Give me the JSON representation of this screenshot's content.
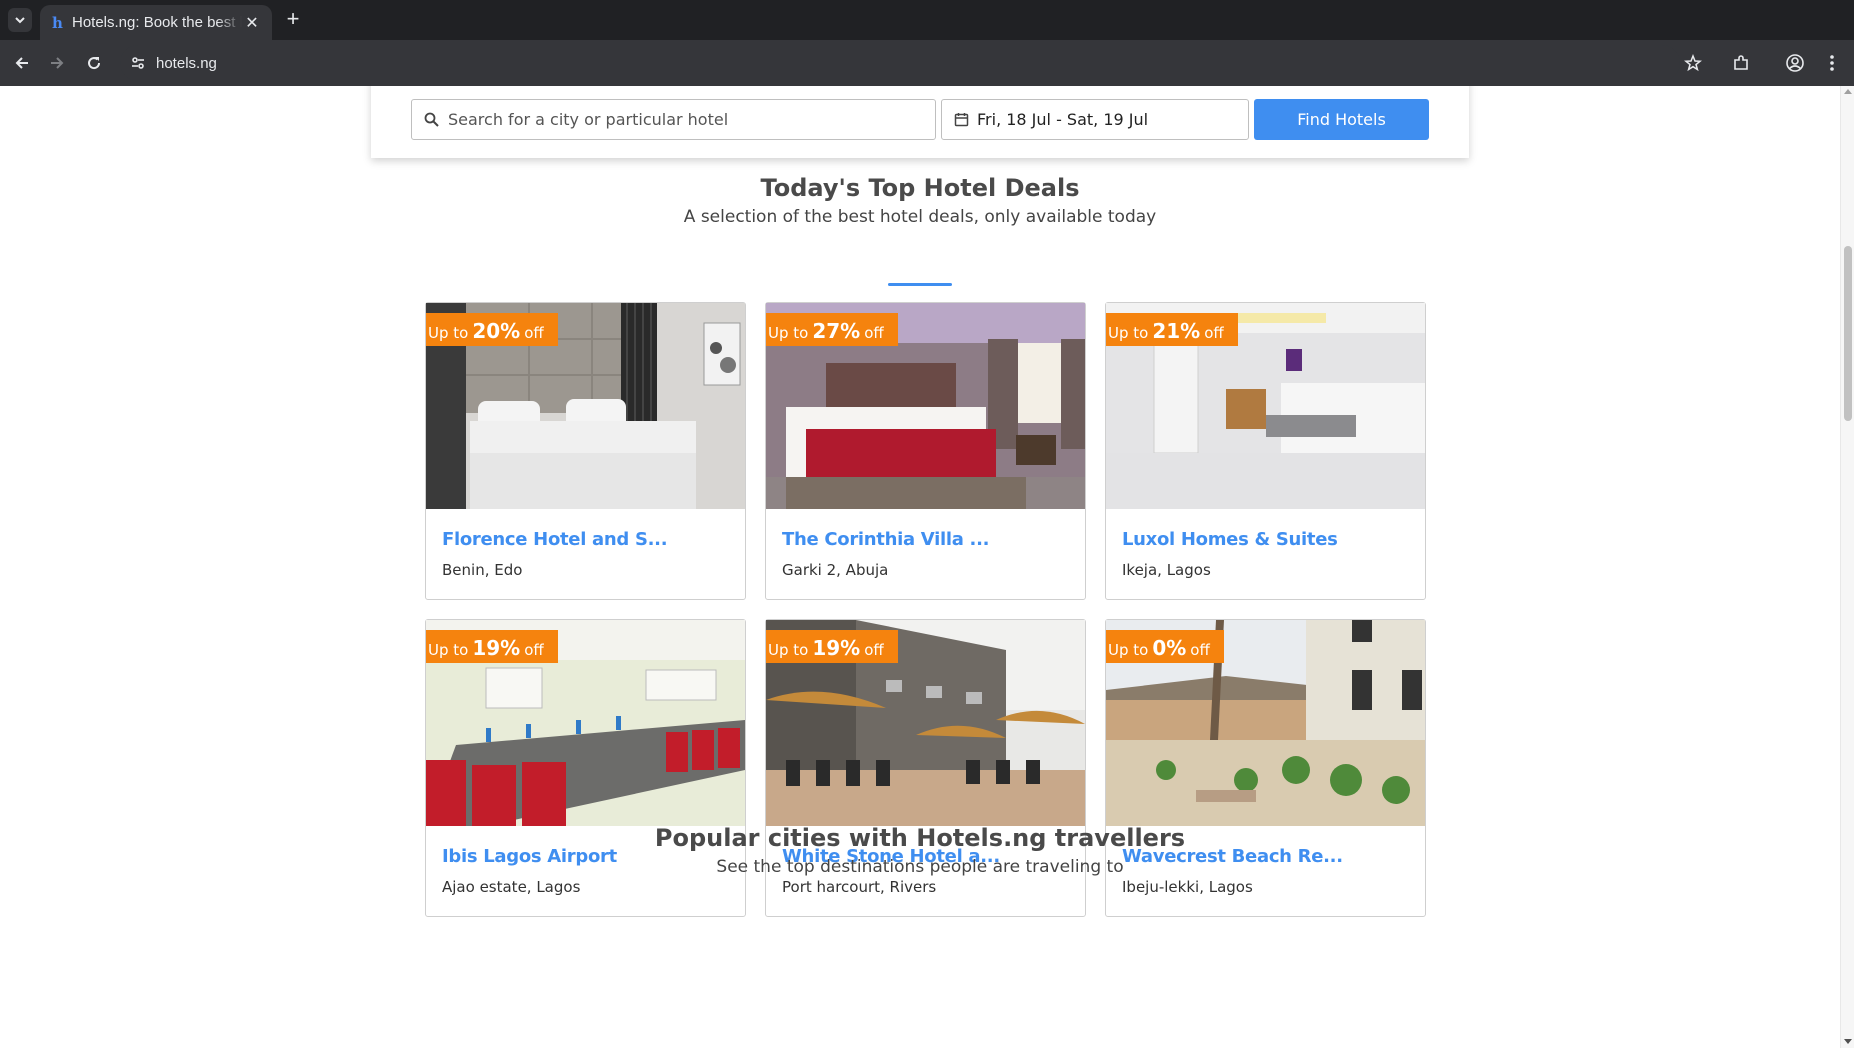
{
  "browser": {
    "tab_title": "Hotels.ng: Book the best hotels",
    "tab_favicon": "h",
    "close_glyph": "✕",
    "new_tab_glyph": "+",
    "url": "hotels.ng",
    "icons": [
      "tab-list-icon",
      "back-icon",
      "forward-icon",
      "reload-icon",
      "site-settings-icon",
      "bookmark-star-icon",
      "extensions-icon",
      "profile-icon",
      "menu-icon"
    ]
  },
  "search": {
    "placeholder": "Search for a city or particular hotel",
    "dates": "Fri, 18 Jul - Sat, 19 Jul",
    "button": "Find Hotels"
  },
  "deals": {
    "title": "Today's Top Hotel Deals",
    "subtitle": "A selection of the best hotel deals, only available today",
    "ribbon_prefix": "Up to",
    "ribbon_suffix": "off",
    "hotels": [
      {
        "name": "Florence Hotel and S...",
        "location": "Benin, Edo",
        "discount": "20%",
        "scene": "bedroom-grey"
      },
      {
        "name": "The Corinthia Villa ...",
        "location": "Garki 2, Abuja",
        "discount": "27%",
        "scene": "bedroom-red"
      },
      {
        "name": "Luxol Homes & Suites",
        "location": "Ikeja, Lagos",
        "discount": "21%",
        "scene": "bedroom-marble"
      },
      {
        "name": "Ibis Lagos Airport",
        "location": "Ajao estate, Lagos",
        "discount": "19%",
        "scene": "conference-room"
      },
      {
        "name": "White Stone Hotel a...",
        "location": "Port harcourt, Rivers",
        "discount": "19%",
        "scene": "patio-umbrellas"
      },
      {
        "name": "Wavecrest Beach Re...",
        "location": "Ibeju-lekki, Lagos",
        "discount": "0%",
        "scene": "beach-garden"
      }
    ]
  },
  "popular": {
    "title": "Popular cities with Hotels.ng travellers",
    "subtitle": "See the top destinations people are traveling to"
  },
  "colors": {
    "accent": "#3f8ef0",
    "ribbon": "#f5830e",
    "chrome_dark": "#202124",
    "chrome_toolbar": "#35363a"
  }
}
